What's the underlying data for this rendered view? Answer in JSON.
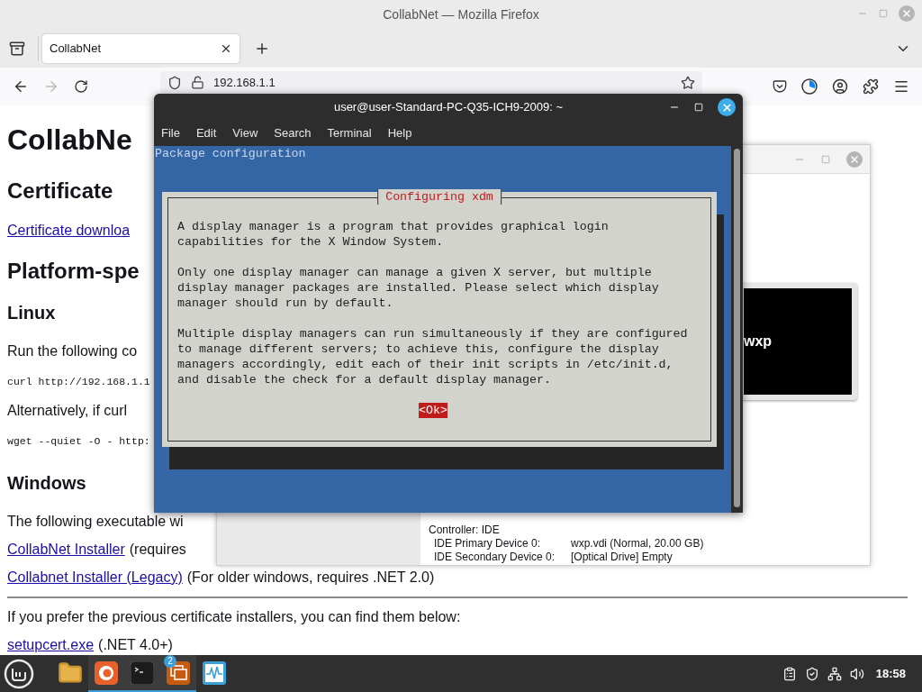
{
  "firefox": {
    "title": "CollabNet — Mozilla Firefox",
    "tabs": [
      {
        "label": "CollabNet",
        "selected": true
      }
    ],
    "forward_disabled": true,
    "url": "192.168.1.1"
  },
  "page": {
    "blocks": [
      {
        "kind": "h1",
        "text": "CollabNe"
      },
      {
        "kind": "h2",
        "text": "Certificate"
      },
      {
        "kind": "p",
        "link": "Certificate downloa"
      },
      {
        "kind": "h2",
        "text": "Platform-spe"
      },
      {
        "kind": "h3",
        "text": "Linux"
      },
      {
        "kind": "p",
        "text": "Run the following co"
      },
      {
        "kind": "code",
        "text": "curl http://192.168.1.1"
      },
      {
        "kind": "p",
        "text": "Alternatively, if curl"
      },
      {
        "kind": "code",
        "text": "wget --quiet -O - http:"
      },
      {
        "kind": "h3",
        "text": "Windows"
      },
      {
        "kind": "p",
        "text": "The following executable wi"
      },
      {
        "kind": "p",
        "link": "CollabNet Installer",
        "text": "(requires"
      },
      {
        "kind": "p",
        "link": "Collabnet Installer (Legacy)",
        "text": "(For older windows, requires .NET 2.0)"
      },
      {
        "kind": "hr"
      },
      {
        "kind": "p",
        "text": "If you prefer the previous certificate installers, you can find them below:"
      },
      {
        "kind": "p",
        "link": "setupcert.exe",
        "text": "(.NET 4.0+)"
      }
    ]
  },
  "virtualbox": {
    "preview_label": "wxp",
    "controller": "Controller: IDE",
    "devices": [
      {
        "device": "IDE Primary Device 0:",
        "value": "wxp.vdi (Normal, 20.00 GB)"
      },
      {
        "device": "IDE Secondary Device 0:",
        "value": "[Optical Drive] Empty"
      }
    ]
  },
  "terminal": {
    "title": "user@user-Standard-PC-Q35-ICH9-2009: ~",
    "menu": [
      "File",
      "Edit",
      "View",
      "Search",
      "Terminal",
      "Help"
    ],
    "header": "Package configuration",
    "dialog": {
      "title": "Configuring xdm",
      "paragraphs": [
        [
          "A display manager is a program that provides graphical login",
          "capabilities for the X Window System."
        ],
        [
          "Only one display manager can manage a given X server, but multiple",
          "display manager packages are installed. Please select which display",
          "manager should run by default."
        ],
        [
          "Multiple display managers can run simultaneously if they are configured",
          "to manage different servers; to achieve this, configure the display",
          "managers accordingly, edit each of their init scripts in /etc/init.d,",
          "and disable the check for a default display manager."
        ]
      ],
      "button": {
        "label": "<Ok>",
        "selected": true
      }
    }
  },
  "taskbar": {
    "apps": [
      {
        "kind": "files",
        "running": false
      },
      {
        "kind": "firefox",
        "running": true
      },
      {
        "kind": "terminal",
        "running": true
      },
      {
        "kind": "virtualbox",
        "running": true,
        "badge": "2"
      },
      {
        "kind": "monitor",
        "running": false
      }
    ],
    "clock": "18:58"
  }
}
